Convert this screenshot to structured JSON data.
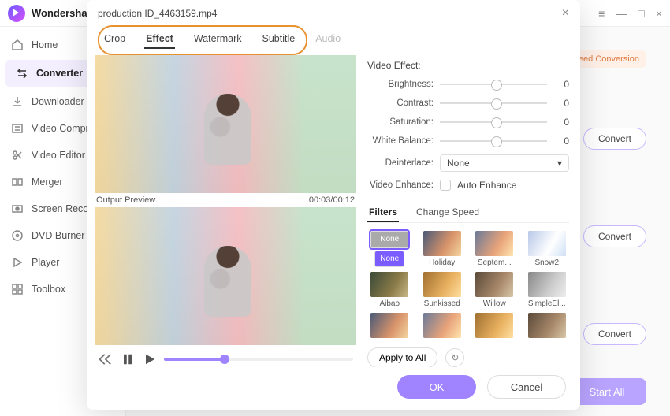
{
  "app": {
    "name": "Wondershare"
  },
  "win_controls": {
    "menu": "≡",
    "min": "—",
    "max": "□",
    "close": "×"
  },
  "sidebar": {
    "items": [
      {
        "label": "Home",
        "icon": "home"
      },
      {
        "label": "Converter",
        "icon": "converter"
      },
      {
        "label": "Downloader",
        "icon": "download"
      },
      {
        "label": "Video Compressor",
        "icon": "compress"
      },
      {
        "label": "Video Editor",
        "icon": "scissors"
      },
      {
        "label": "Merger",
        "icon": "merge"
      },
      {
        "label": "Screen Recorder",
        "icon": "record"
      },
      {
        "label": "DVD Burner",
        "icon": "disc"
      },
      {
        "label": "Player",
        "icon": "play"
      },
      {
        "label": "Toolbox",
        "icon": "toolbox"
      }
    ]
  },
  "content": {
    "speed_badge": "Speed Conversion",
    "convert_label": "Convert",
    "start_all": "Start All"
  },
  "dialog": {
    "filename": "production ID_4463159.mp4",
    "tabs": [
      "Crop",
      "Effect",
      "Watermark",
      "Subtitle",
      "Audio"
    ],
    "active_tab": "Effect",
    "disabled_tab": "Audio",
    "output_preview_label": "Output Preview",
    "timecode": "00:03/00:12",
    "video_effect": {
      "title": "Video Effect:",
      "brightness": {
        "label": "Brightness:",
        "value": 0
      },
      "contrast": {
        "label": "Contrast:",
        "value": 0
      },
      "saturation": {
        "label": "Saturation:",
        "value": 0
      },
      "white_balance": {
        "label": "White Balance:",
        "value": 0
      },
      "deinterlace": {
        "label": "Deinterlace:",
        "value": "None"
      },
      "enhance": {
        "label": "Video Enhance:",
        "checkbox": "Auto Enhance"
      }
    },
    "sub_tabs": [
      "Filters",
      "Change Speed"
    ],
    "active_sub_tab": "Filters",
    "filters": [
      {
        "name": "None",
        "selected": true,
        "variant": "none"
      },
      {
        "name": "Holiday",
        "variant": "v1"
      },
      {
        "name": "Septem...",
        "variant": "v2"
      },
      {
        "name": "Snow2",
        "variant": "v3"
      },
      {
        "name": "Aibao",
        "variant": "v4"
      },
      {
        "name": "Sunkissed",
        "variant": "v5"
      },
      {
        "name": "Willow",
        "variant": "v6"
      },
      {
        "name": "SimpleEl...",
        "variant": "v7"
      },
      {
        "name": "",
        "variant": "v1"
      },
      {
        "name": "",
        "variant": "v2"
      },
      {
        "name": "",
        "variant": "v5"
      },
      {
        "name": "",
        "variant": "v6"
      }
    ],
    "apply_all": "Apply to All",
    "ok": "OK",
    "cancel": "Cancel"
  }
}
